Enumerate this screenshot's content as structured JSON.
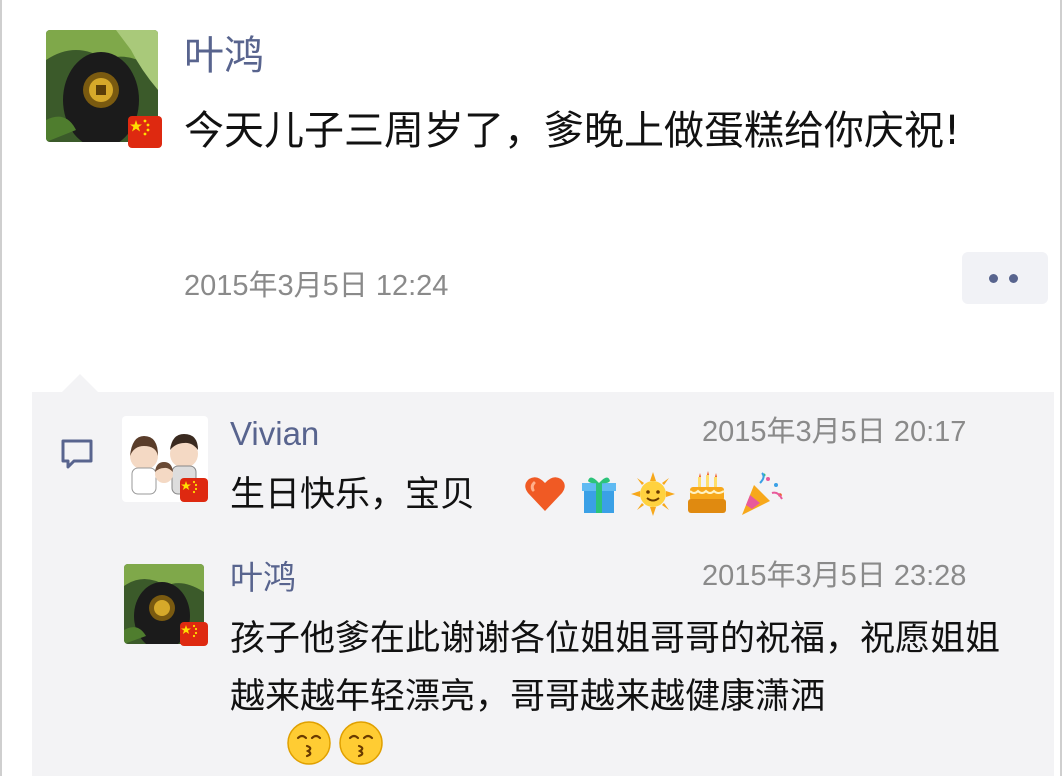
{
  "post": {
    "author": "叶鸿",
    "text": "今天儿子三周岁了，爹晚上做蛋糕给你庆祝!",
    "time": "2015年3月5日 12:24"
  },
  "comments": [
    {
      "author": "Vivian",
      "time": "2015年3月5日 20:17",
      "text": "生日快乐，宝贝",
      "emojis": [
        "heart-icon",
        "gift-icon",
        "sun-icon",
        "cake-icon",
        "party-popper-icon"
      ]
    },
    {
      "author": "叶鸿",
      "time": "2015年3月5日 23:28",
      "text": "孩子他爹在此谢谢各位姐姐哥哥的祝福，祝愿姐姐越来越年轻漂亮，哥哥越来越健康潇洒",
      "emojis": [
        "kiss-face-icon",
        "kiss-face-icon"
      ]
    }
  ],
  "colors": {
    "name": "#58648e",
    "time": "#8a8a8a",
    "comment_bg": "#f3f3f5"
  }
}
